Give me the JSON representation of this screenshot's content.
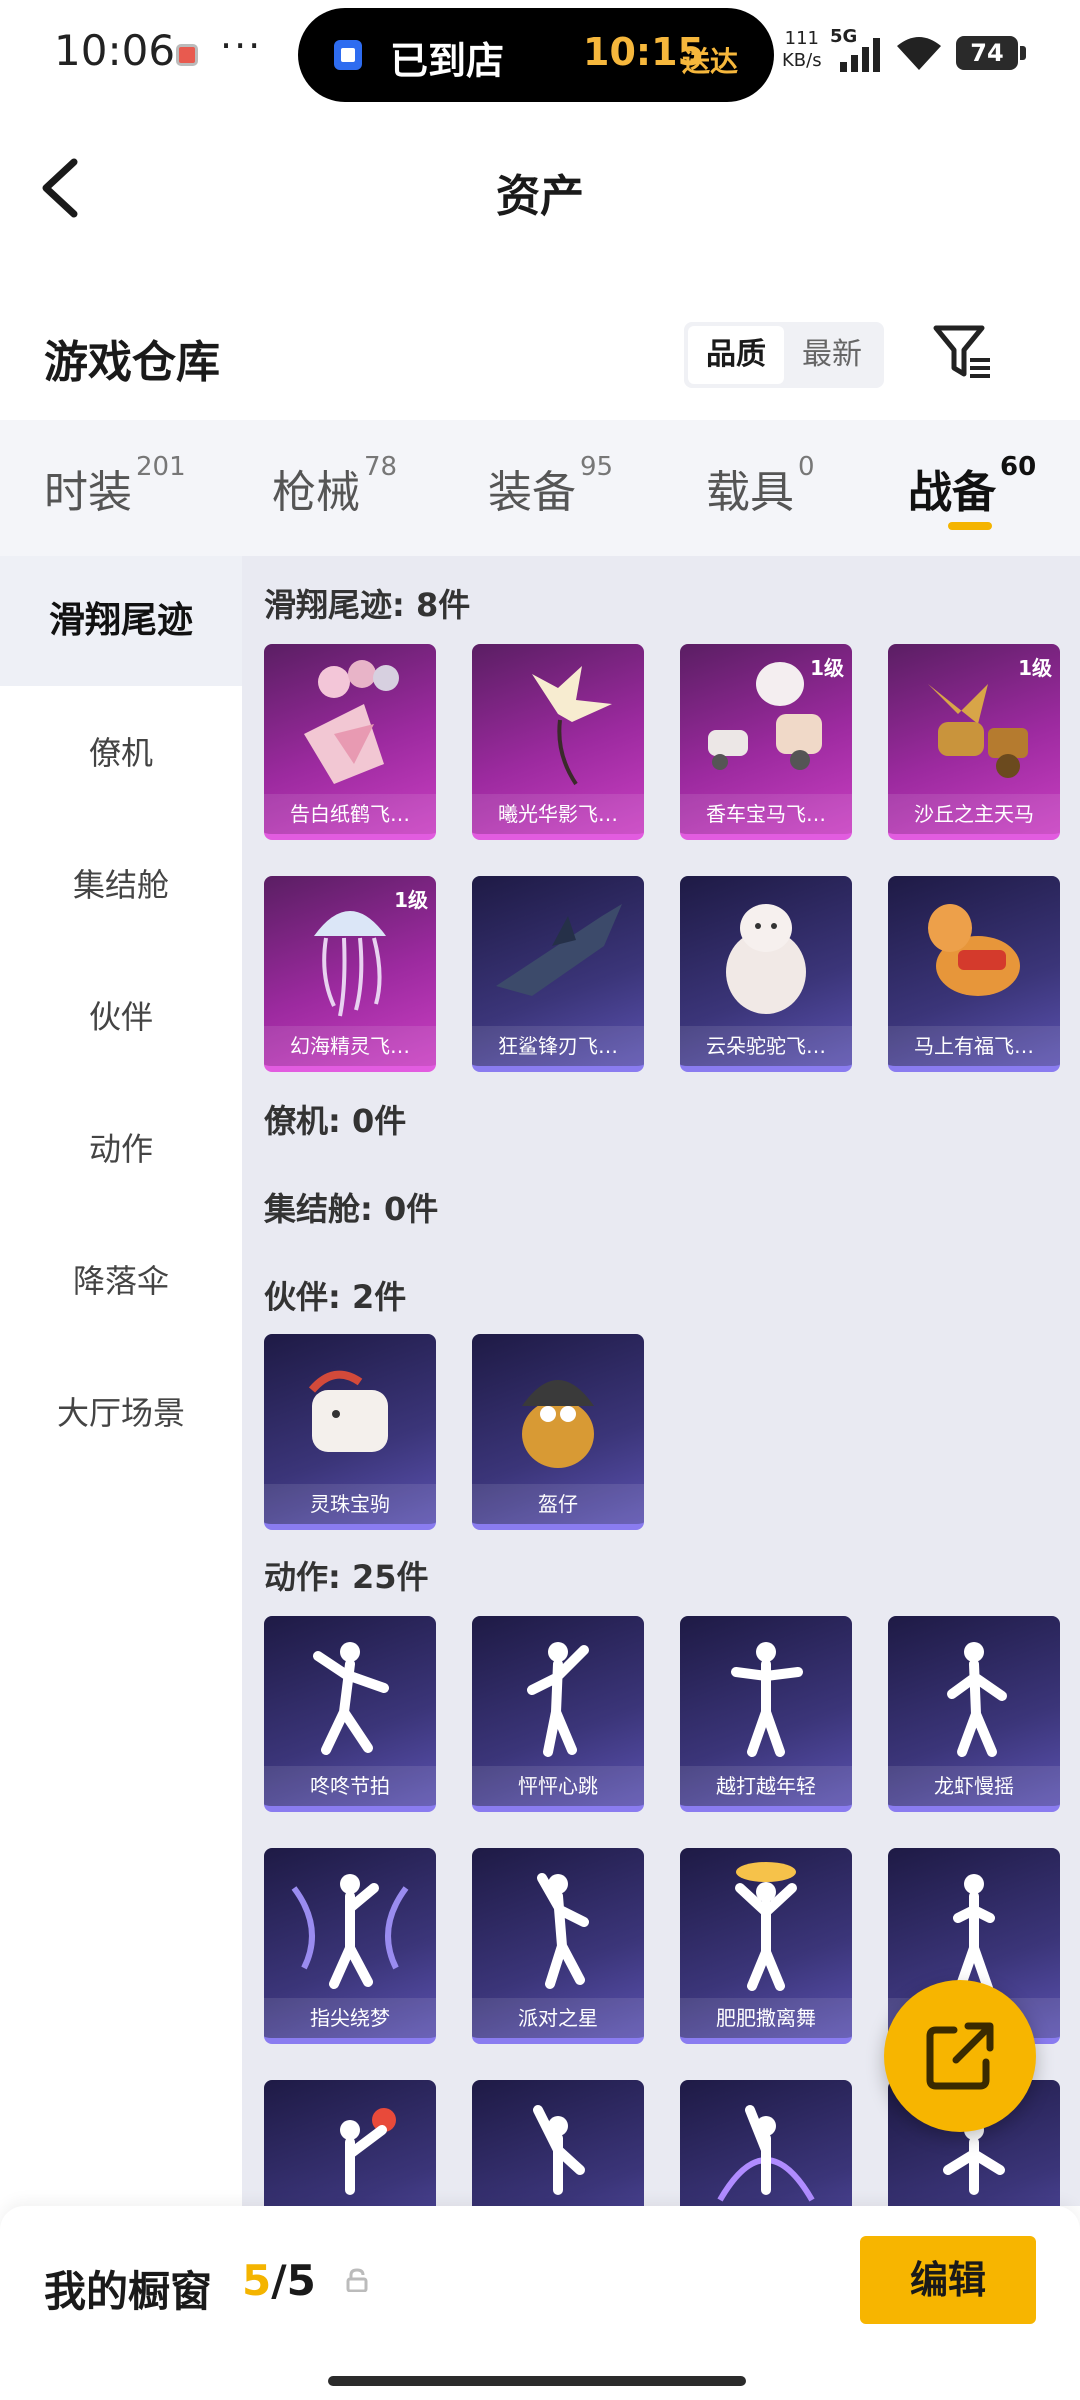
{
  "status_bar": {
    "time": "10:06",
    "dots": "···",
    "island_text": "已到店",
    "island_eta": "10:15",
    "island_eta_label": "送达",
    "speed_value": "111",
    "speed_unit": "KB/s",
    "network": "5G",
    "battery": "74"
  },
  "header": {
    "title": "资产"
  },
  "warehouse": {
    "title": "游戏仓库",
    "sort_options": [
      "品质",
      "最新"
    ],
    "active_sort": "品质"
  },
  "tabs": [
    {
      "label": "时装",
      "count": "201"
    },
    {
      "label": "枪械",
      "count": "78"
    },
    {
      "label": "装备",
      "count": "95"
    },
    {
      "label": "载具",
      "count": "0"
    },
    {
      "label": "战备",
      "count": "60",
      "active": true
    }
  ],
  "sidebar": {
    "items": [
      "滑翔尾迹",
      "僚机",
      "集结舱",
      "伙伴",
      "动作",
      "降落伞",
      "大厅场景"
    ],
    "active": "滑翔尾迹"
  },
  "sections": [
    {
      "title": "滑翔尾迹: 8件",
      "items": [
        {
          "name": "告白纸鹤飞…",
          "level": "",
          "tier": "pink"
        },
        {
          "name": "曦光华影飞…",
          "level": "",
          "tier": "pink"
        },
        {
          "name": "香车宝马飞…",
          "level": "1级",
          "tier": "pink"
        },
        {
          "name": "沙丘之主天马",
          "level": "1级",
          "tier": "pink"
        },
        {
          "name": "幻海精灵飞…",
          "level": "1级",
          "tier": "pink"
        },
        {
          "name": "狂鲨锋刃飞…",
          "level": "",
          "tier": "blue"
        },
        {
          "name": "云朵驼驼飞…",
          "level": "",
          "tier": "blue"
        },
        {
          "name": "马上有福飞…",
          "level": "",
          "tier": "blue"
        }
      ]
    },
    {
      "title": "僚机: 0件",
      "items": []
    },
    {
      "title": "集结舱: 0件",
      "items": []
    },
    {
      "title": "伙伴: 2件",
      "items": [
        {
          "name": "灵珠宝驹",
          "level": "",
          "tier": "blue"
        },
        {
          "name": "盔仔",
          "level": "",
          "tier": "blue"
        }
      ]
    },
    {
      "title": "动作: 25件",
      "items": [
        {
          "name": "咚咚节拍",
          "level": "",
          "tier": "blue"
        },
        {
          "name": "怦怦心跳",
          "level": "",
          "tier": "blue"
        },
        {
          "name": "越打越年轻",
          "level": "",
          "tier": "blue"
        },
        {
          "name": "龙虾慢摇",
          "level": "",
          "tier": "blue"
        },
        {
          "name": "指尖绕梦",
          "level": "",
          "tier": "blue"
        },
        {
          "name": "派对之星",
          "level": "",
          "tier": "blue"
        },
        {
          "name": "肥肥撒离舞",
          "level": "",
          "tier": "blue"
        },
        {
          "name": "",
          "level": "",
          "tier": "blue"
        },
        {
          "name": "",
          "level": "",
          "tier": "blue"
        },
        {
          "name": "",
          "level": "",
          "tier": "blue"
        },
        {
          "name": "",
          "level": "",
          "tier": "blue"
        },
        {
          "name": "",
          "level": "",
          "tier": "blue"
        }
      ]
    }
  ],
  "bottom_bar": {
    "title": "我的橱窗",
    "count_current": "5",
    "count_sep": "/",
    "count_total": "5",
    "edit_label": "编辑"
  }
}
